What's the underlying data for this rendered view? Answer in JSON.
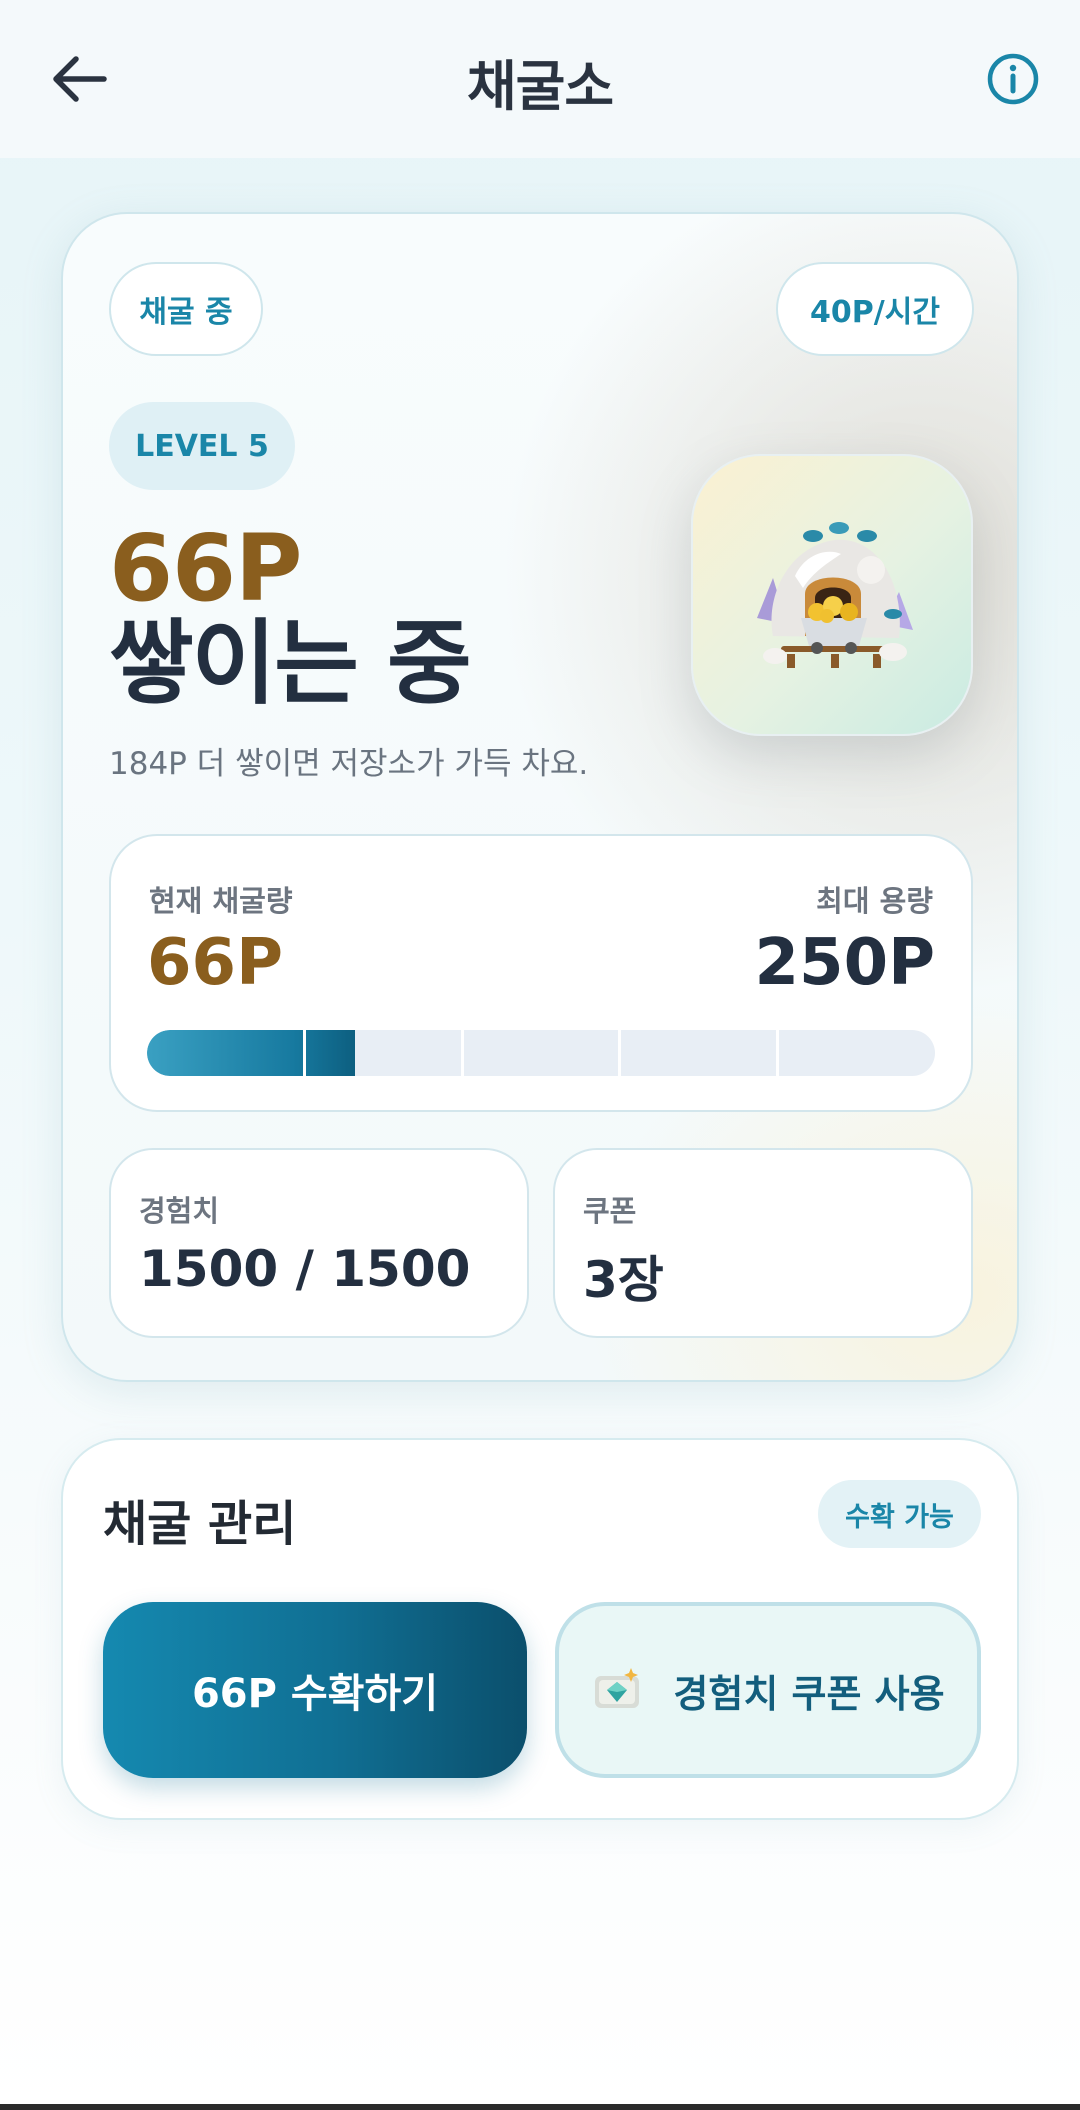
{
  "header": {
    "title": "채굴소",
    "back_icon": "arrow-left-icon",
    "info_icon": "info-icon"
  },
  "mining_card": {
    "status_label": "채굴 중",
    "rate_label": "40P/시간",
    "level_label": "LEVEL 5",
    "accumulated_points": "66P",
    "accumulating_text": "쌓이는 중",
    "hint_text": "184P 더 쌓이면 저장소가 가득 차요.",
    "mine_image": "mine-cart-gold-icon",
    "capacity": {
      "current_label": "현재 채굴량",
      "current_value": "66P",
      "max_label": "최대 용량",
      "max_value": "250P",
      "progress_fraction": 0.264,
      "segments": 5
    },
    "stats": {
      "exp_label": "경험치",
      "exp_value": "1500 / 1500",
      "coupon_label": "쿠폰",
      "coupon_value": "3장"
    }
  },
  "management": {
    "title": "채굴 관리",
    "badge": "수확 가능",
    "harvest_button": "66P 수확하기",
    "coupon_button": "경험치 쿠폰 사용",
    "coupon_icon": "exp-gem-coupon-icon"
  },
  "colors": {
    "accent": "#1a86a8",
    "points_gold": "#8a5e1e",
    "dark_text": "#232f40",
    "button_dark": "#0b4f6c"
  }
}
